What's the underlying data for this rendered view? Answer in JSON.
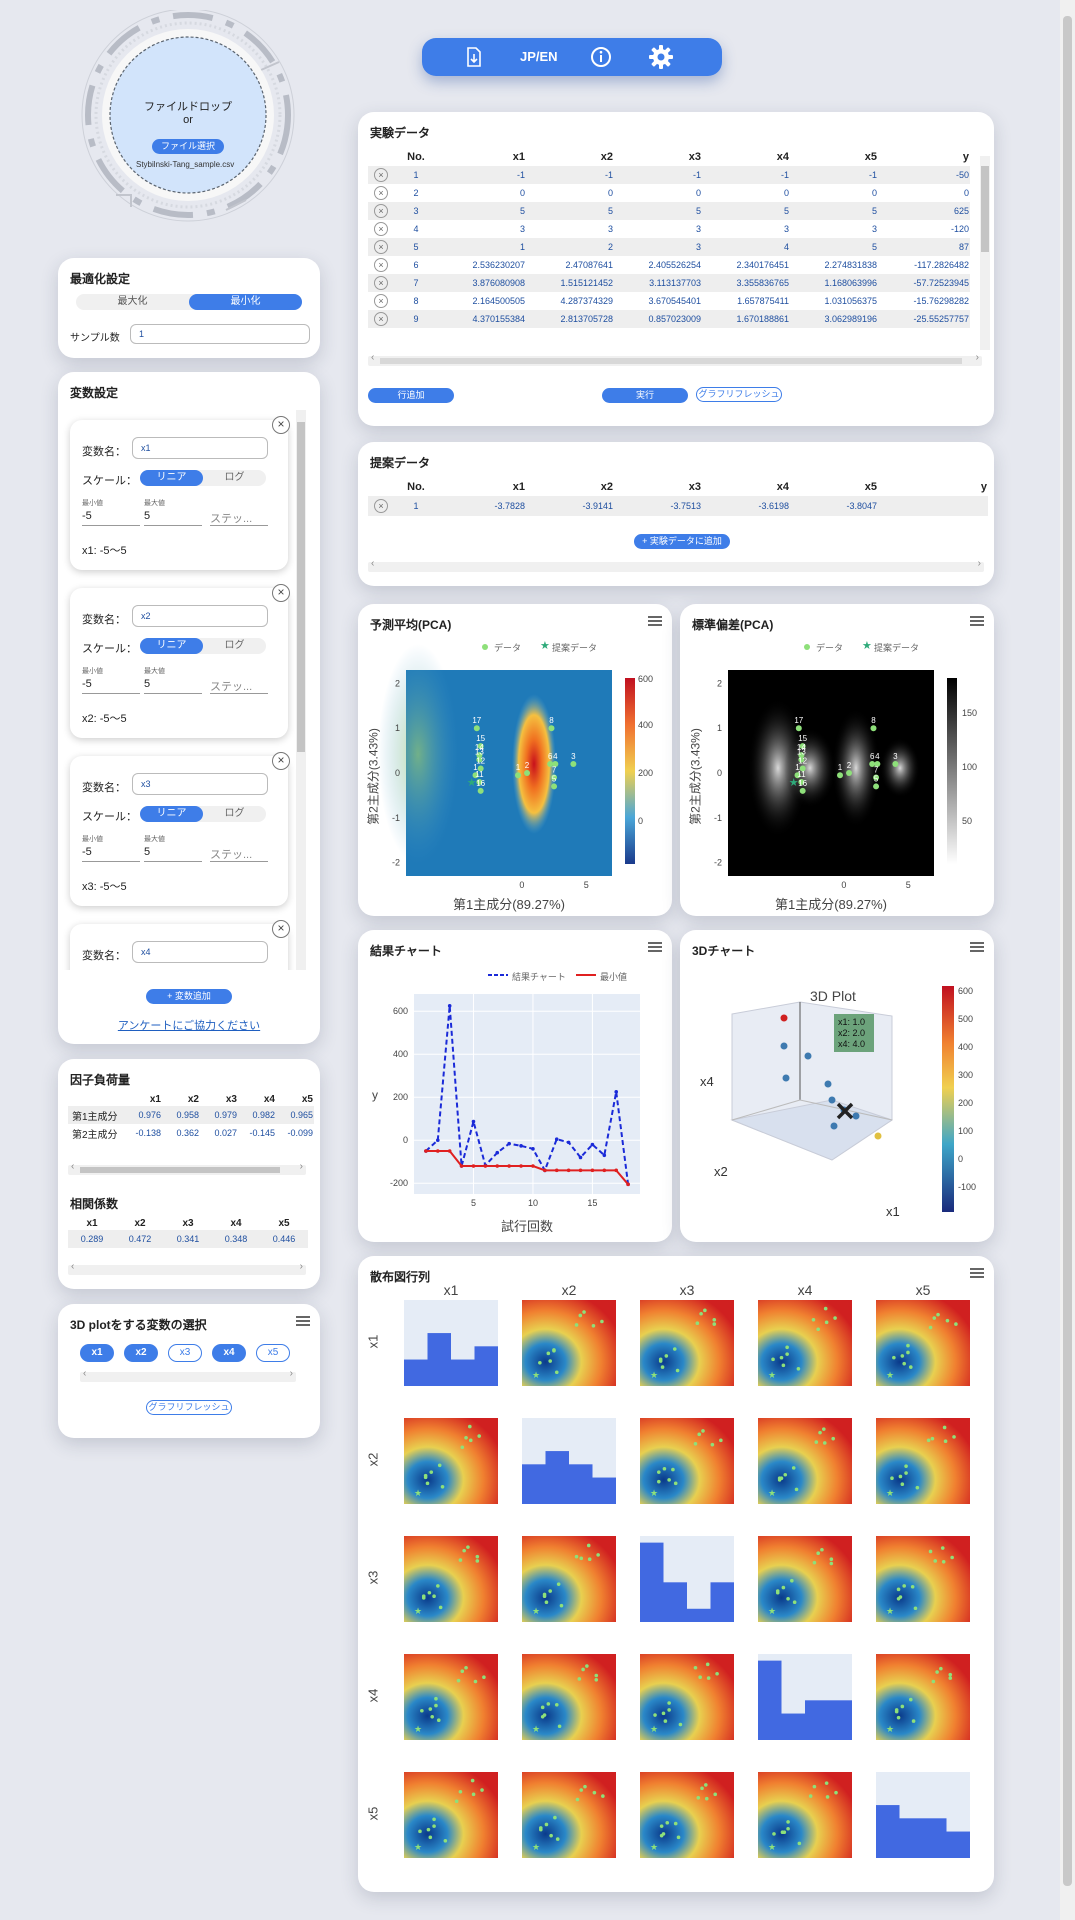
{
  "toolbar": {
    "lang": "JP/EN"
  },
  "drop": {
    "title": "ファイルドロップ",
    "or": "or",
    "button": "ファイル選択",
    "filename": "Stybilnski-Tang_sample.csv"
  },
  "opt": {
    "title": "最適化設定",
    "max": "最大化",
    "min": "最小化",
    "samples_label": "サンプル数",
    "samples_value": "1"
  },
  "vars": {
    "title": "変数設定",
    "name_label": "変数名：",
    "scale_label": "スケール：",
    "linear": "リニア",
    "log": "ログ",
    "min_label": "最小値",
    "max_label": "最大値",
    "step_ph": "ステッ...",
    "items": [
      {
        "name": "x1",
        "min": "-5",
        "max": "5",
        "range": "x1: -5〜5"
      },
      {
        "name": "x2",
        "min": "-5",
        "max": "5",
        "range": "x2: -5〜5"
      },
      {
        "name": "x3",
        "min": "-5",
        "max": "5",
        "range": "x3: -5〜5"
      },
      {
        "name": "x4"
      }
    ],
    "add": "+ 変数追加",
    "survey": "アンケートにご協力ください"
  },
  "loading": {
    "title": "因子負荷量",
    "cols": [
      "x1",
      "x2",
      "x3",
      "x4",
      "x5"
    ],
    "rows": [
      {
        "label": "第1主成分",
        "vals": [
          "0.976",
          "0.958",
          "0.979",
          "0.982",
          "0.965"
        ]
      },
      {
        "label": "第2主成分",
        "vals": [
          "-0.138",
          "0.362",
          "0.027",
          "-0.145",
          "-0.099"
        ]
      }
    ]
  },
  "corr": {
    "title": "相関係数",
    "cols": [
      "x1",
      "x2",
      "x3",
      "x4",
      "x5"
    ],
    "vals": [
      "0.289",
      "0.472",
      "0.341",
      "0.348",
      "0.446"
    ]
  },
  "plot3dsel": {
    "title": "3D plotをする変数の選択",
    "chips": [
      "x1",
      "x2",
      "x3",
      "x4",
      "x5"
    ],
    "refresh": "グラフリフレッシュ"
  },
  "exp": {
    "title": "実験データ",
    "headers": [
      "No.",
      "x1",
      "x2",
      "x3",
      "x4",
      "x5",
      "y"
    ],
    "rows": [
      [
        "1",
        "-1",
        "-1",
        "-1",
        "-1",
        "-1",
        "-50"
      ],
      [
        "2",
        "0",
        "0",
        "0",
        "0",
        "0",
        "0"
      ],
      [
        "3",
        "5",
        "5",
        "5",
        "5",
        "5",
        "625"
      ],
      [
        "4",
        "3",
        "3",
        "3",
        "3",
        "3",
        "-120"
      ],
      [
        "5",
        "1",
        "2",
        "3",
        "4",
        "5",
        "87"
      ],
      [
        "6",
        "2.536230207",
        "2.47087641",
        "2.405526254",
        "2.340176451",
        "2.274831838",
        "-117.2826482"
      ],
      [
        "7",
        "3.876080908",
        "1.515121452",
        "3.113137703",
        "3.355836765",
        "1.168063996",
        "-57.72523945"
      ],
      [
        "8",
        "2.164500505",
        "4.287374329",
        "3.670545401",
        "1.657875411",
        "1.031056375",
        "-15.76298282"
      ],
      [
        "9",
        "4.370155384",
        "2.813705728",
        "0.857023009",
        "1.670188861",
        "3.062989196",
        "-25.55257757"
      ]
    ],
    "add_row": "行追加",
    "run": "実行",
    "refresh": "グラフリフレッシュ"
  },
  "prop": {
    "title": "提案データ",
    "headers": [
      "No.",
      "x1",
      "x2",
      "x3",
      "x4",
      "x5",
      "y"
    ],
    "row": [
      "1",
      "-3.7828",
      "-3.9141",
      "-3.7513",
      "-3.6198",
      "-3.8047",
      ""
    ],
    "add": "+ 実験データに追加"
  },
  "pca_mean": {
    "title": "予測平均(PCA)",
    "legend": [
      "データ",
      "提案データ"
    ],
    "xlabel": "第1主成分(89.27%)",
    "ylabel": "第2主成分(3.43%)",
    "colorbar": [
      "600",
      "400",
      "200",
      "0"
    ]
  },
  "pca_std": {
    "title": "標準偏差(PCA)",
    "legend": [
      "データ",
      "提案データ"
    ],
    "xlabel": "第1主成分(89.27%)",
    "ylabel": "第2主成分(3.43%)",
    "colorbar": [
      "150",
      "100",
      "50"
    ]
  },
  "result": {
    "title": "結果チャート",
    "legend": [
      "結果チャート",
      "最小値"
    ],
    "xlabel": "試行回数",
    "ylabel": "y"
  },
  "chart3d": {
    "title": "3Dチャート",
    "plot_title": "3D Plot",
    "axes": [
      "x1",
      "x2",
      "x4"
    ],
    "tooltip": [
      "x1: 1.0",
      "x2: 2.0",
      "x4: 4.0"
    ],
    "colorbar": [
      "600",
      "500",
      "400",
      "300",
      "200",
      "100",
      "0",
      "-100"
    ]
  },
  "scatter": {
    "title": "散布図行列",
    "vars": [
      "x1",
      "x2",
      "x3",
      "x4",
      "x5"
    ]
  },
  "chart_data": [
    {
      "type": "line",
      "title": "結果チャート",
      "xlabel": "試行回数",
      "ylabel": "y",
      "x": [
        1,
        2,
        3,
        4,
        5,
        6,
        7,
        8,
        9,
        10,
        11,
        12,
        13,
        14,
        15,
        16,
        17,
        18
      ],
      "series": [
        {
          "name": "結果チャート",
          "values": [
            -50,
            0,
            625,
            -120,
            87,
            -117,
            -58,
            -16,
            -26,
            -40,
            -140,
            5,
            -10,
            -80,
            -20,
            -70,
            225,
            -205
          ]
        },
        {
          "name": "最小値",
          "values": [
            -50,
            -50,
            -50,
            -120,
            -120,
            -120,
            -120,
            -120,
            -120,
            -120,
            -140,
            -140,
            -140,
            -140,
            -140,
            -140,
            -140,
            -205
          ]
        }
      ],
      "xlim": [
        0,
        19
      ],
      "ylim": [
        -250,
        680
      ],
      "yticks": [
        -200,
        0,
        200,
        400,
        600
      ],
      "xticks": [
        5,
        10,
        15
      ]
    },
    {
      "type": "scatter",
      "title": "予測平均(PCA)",
      "xlabel": "第1主成分(89.27%)",
      "ylabel": "第2主成分(3.43%)",
      "xlim": [
        -9,
        7
      ],
      "ylim": [
        -2.3,
        2.3
      ],
      "xticks": [
        0,
        5
      ],
      "yticks": [
        -2,
        -1,
        0,
        1,
        2
      ],
      "points": [
        {
          "label": "17",
          "x": -3.5,
          "y": 1.0
        },
        {
          "label": "15",
          "x": -3.2,
          "y": 0.6
        },
        {
          "label": "14",
          "x": -3.3,
          "y": 0.4
        },
        {
          "label": "13",
          "x": -3.3,
          "y": 0.3
        },
        {
          "label": "12",
          "x": -3.2,
          "y": 0.1
        },
        {
          "label": "1",
          "x": -3.6,
          "y": -0.05
        },
        {
          "label": "11",
          "x": -3.3,
          "y": -0.2
        },
        {
          "label": "16",
          "x": -3.2,
          "y": -0.4
        },
        {
          "label": "1",
          "x": -0.3,
          "y": -0.05
        },
        {
          "label": "2",
          "x": 0.4,
          "y": 0.0
        },
        {
          "label": "8",
          "x": 2.3,
          "y": 1.0
        },
        {
          "label": "6",
          "x": 2.2,
          "y": 0.2
        },
        {
          "label": "4",
          "x": 2.6,
          "y": 0.2
        },
        {
          "label": "7",
          "x": 2.5,
          "y": -0.1
        },
        {
          "label": "5",
          "x": 2.5,
          "y": -0.3
        },
        {
          "label": "3",
          "x": 4.0,
          "y": 0.2
        }
      ],
      "proposed": {
        "x": -3.9,
        "y": -0.2
      }
    }
  ]
}
